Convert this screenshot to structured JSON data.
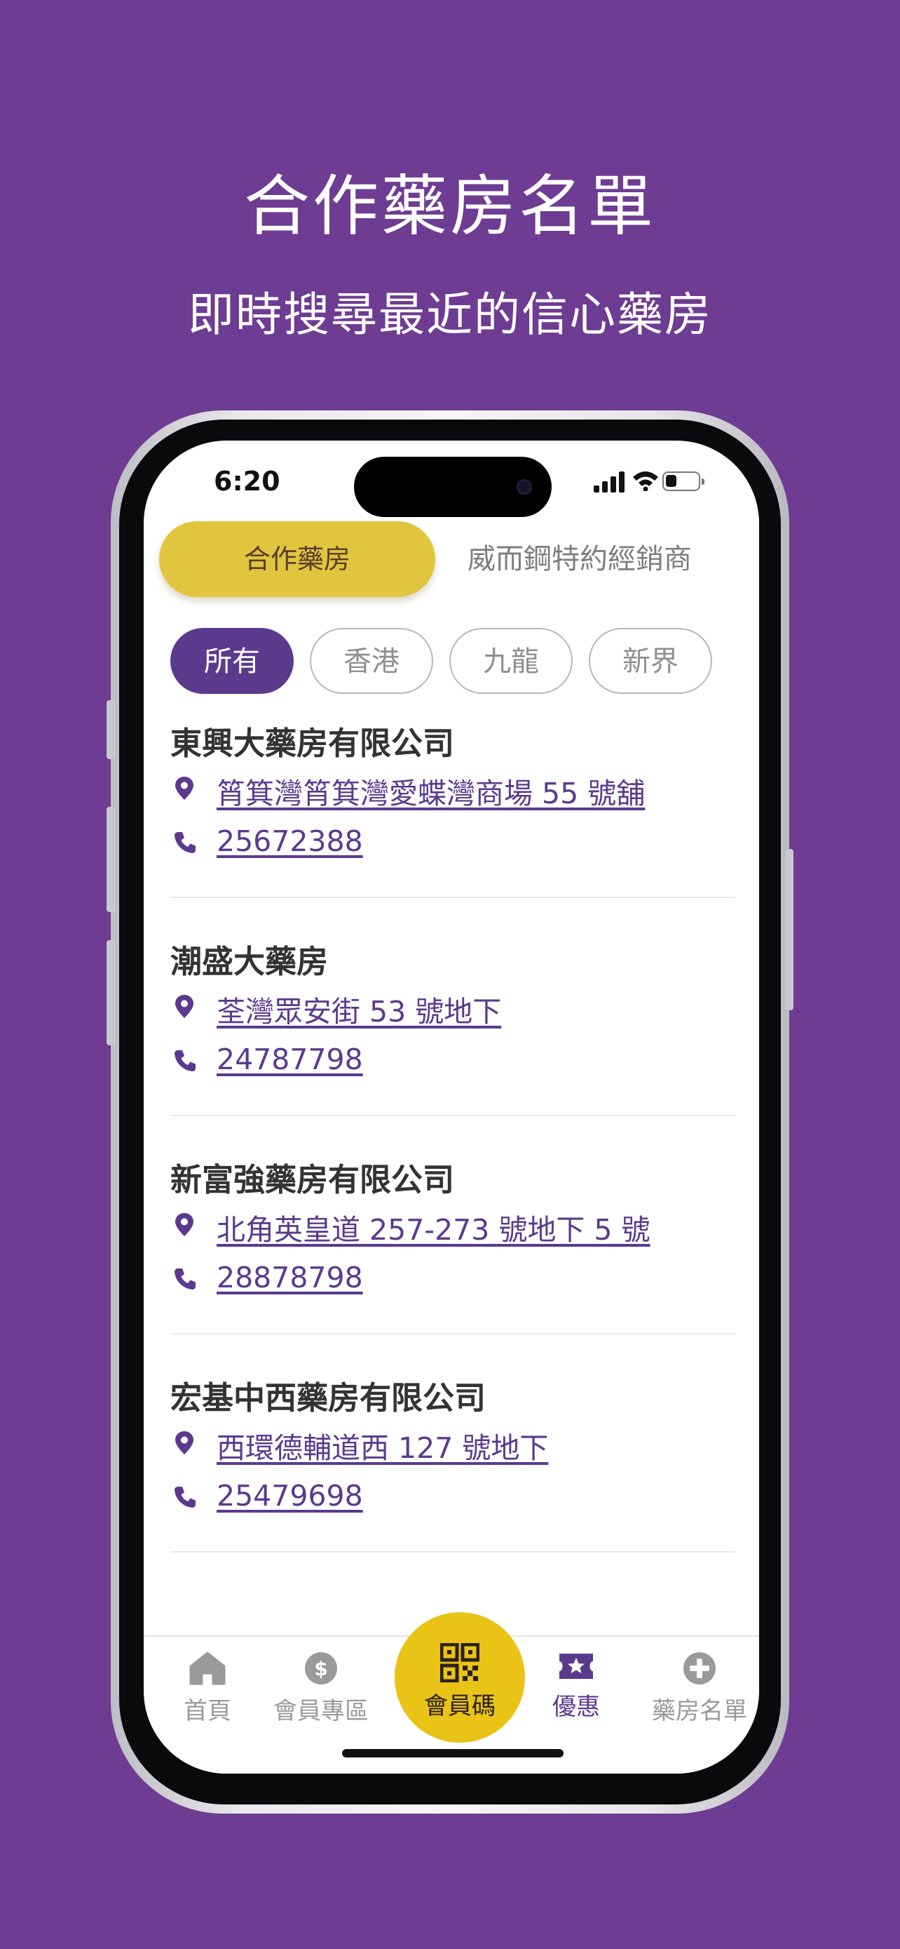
{
  "promo": {
    "headline": "合作藥房名單",
    "subheadline": "即時搜尋最近的信心藥房"
  },
  "status_bar": {
    "time": "6:20",
    "battery_level": 0.35
  },
  "segment_tabs": {
    "active": "合作藥房",
    "inactive": "威而鋼特約經銷商"
  },
  "region_filters": [
    "所有",
    "香港",
    "九龍",
    "新界"
  ],
  "pharmacies": [
    {
      "name": "東興大藥房有限公司",
      "address": "筲箕灣筲箕灣愛蝶灣商場 55 號舖",
      "phone": "25672388"
    },
    {
      "name": "潮盛大藥房",
      "address": "荃灣眾安街 53 號地下",
      "phone": "24787798"
    },
    {
      "name": "新富強藥房有限公司",
      "address": "北角英皇道 257-273 號地下 5 號",
      "phone": "28878798"
    },
    {
      "name": "宏基中西藥房有限公司",
      "address": "西環德輔道西 127 號地下",
      "phone": "25479698"
    }
  ],
  "bottom_nav": {
    "home": "首頁",
    "member_zone": "會員專區",
    "member_code": "會員碼",
    "offers": "優惠",
    "pharmacy_list": "藥房名單"
  },
  "colors": {
    "background": "#6e3c92",
    "brand_purple": "#5b3a8e",
    "accent_yellow": "#e1c53e",
    "center_button": "#e9c316"
  },
  "icons": [
    "location-pin-icon",
    "phone-icon",
    "home-icon",
    "dollar-coin-icon",
    "qr-code-icon",
    "ticket-star-icon",
    "plus-circle-icon",
    "signal-icon",
    "wifi-icon",
    "battery-icon"
  ]
}
